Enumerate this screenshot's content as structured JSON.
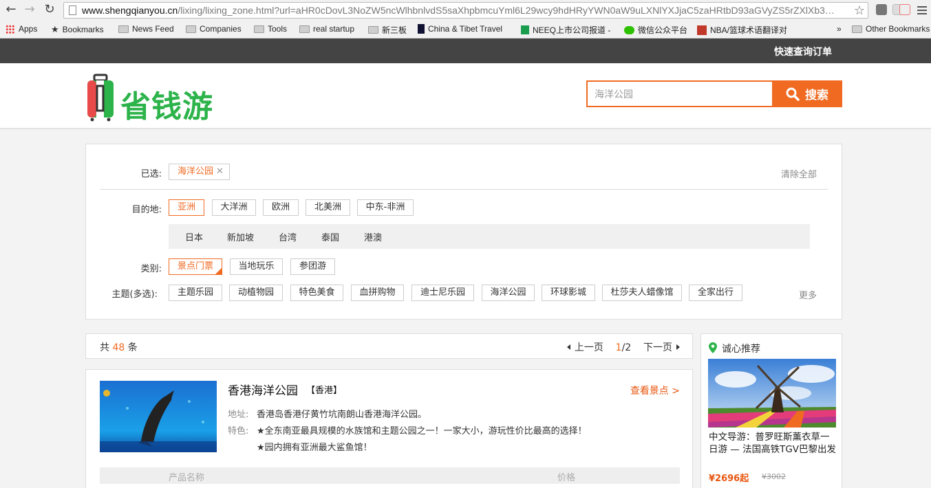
{
  "browser": {
    "url_host": "www.shengqianyou.cn",
    "url_rest": "/lixing/lixing_zone.html?url=aHR0cDovL3NoZW5ncWlhbnlvdS5saXhpbmcuYml6L29wcy9hdHRyYWN0aW9uLXNlYXJjaC5zaHRtbD93aGVyZS5rZXlXb3…"
  },
  "bookmarks": [
    {
      "label": "Apps",
      "icon": "apps-icon"
    },
    {
      "label": "Bookmarks",
      "icon": "star-icon"
    },
    {
      "label": "News Feed",
      "icon": "folder-icon"
    },
    {
      "label": "Companies",
      "icon": "folder-icon"
    },
    {
      "label": "Tools",
      "icon": "folder-icon"
    },
    {
      "label": "real startup",
      "icon": "folder-icon"
    },
    {
      "label": "新三板",
      "icon": "folder-icon"
    },
    {
      "label": "China & Tibet Travel",
      "icon": "china-tibet-icon"
    },
    {
      "label": "NEEQ上市公司报道 -",
      "icon": "sheet-icon"
    },
    {
      "label": "微信公众平台",
      "icon": "wechat-icon"
    },
    {
      "label": "NBA/篮球术语翻译对",
      "icon": "nba-icon"
    },
    {
      "label": "»",
      "icon": ""
    },
    {
      "label": "Other Bookmarks",
      "icon": "folder-icon"
    }
  ],
  "site": {
    "quick_order": "快速查询订单",
    "logo_text": "省钱游",
    "search_value": "海洋公园",
    "search_button": "搜索"
  },
  "filters": {
    "selected_label": "已选:",
    "selected_chip": "海洋公园",
    "clear_all": "清除全部",
    "destination_label": "目的地:",
    "destinations": [
      "亚洲",
      "大洋洲",
      "欧洲",
      "北美洲",
      "中东-非洲"
    ],
    "sub_regions": [
      "日本",
      "新加坡",
      "台湾",
      "泰国",
      "港澳"
    ],
    "category_label": "类别:",
    "categories": [
      "景点门票",
      "当地玩乐",
      "参团游"
    ],
    "theme_label": "主题(多选):",
    "themes": [
      "主题乐园",
      "动植物园",
      "特色美食",
      "血拼购物",
      "迪士尼乐园",
      "海洋公园",
      "环球影城",
      "杜莎夫人蜡像馆",
      "全家出行"
    ],
    "more": "更多"
  },
  "results": {
    "count_prefix": "共",
    "count": "48",
    "count_suffix": "条",
    "prev": "上一页",
    "page_current": "1",
    "page_total": "/2",
    "next": "下一页"
  },
  "item": {
    "name": "香港海洋公园",
    "location": "【香港】",
    "view_link": "查看景点 >",
    "address_label": "地址:",
    "address": "香港岛香港仔黄竹坑南朗山香港海洋公园。",
    "feature_label": "特色:",
    "feature_1": "★全东南亚最具规模的水族馆和主题公园之一！一家大小，游玩性价比最高的选择！",
    "feature_2": "★园内拥有亚洲最大鲨鱼馆！",
    "col_name": "产品名称",
    "col_price": "价格"
  },
  "recommend": {
    "title": "诚心推荐",
    "text": "中文导游：普罗旺斯薰衣草一日游 — 法国高铁TGV巴黎出发",
    "price": "¥2696起",
    "old_price": "¥3002"
  },
  "colors": {
    "accent": "#f06a22",
    "brand_green": "#2cb34a",
    "topbar": "#444444"
  }
}
